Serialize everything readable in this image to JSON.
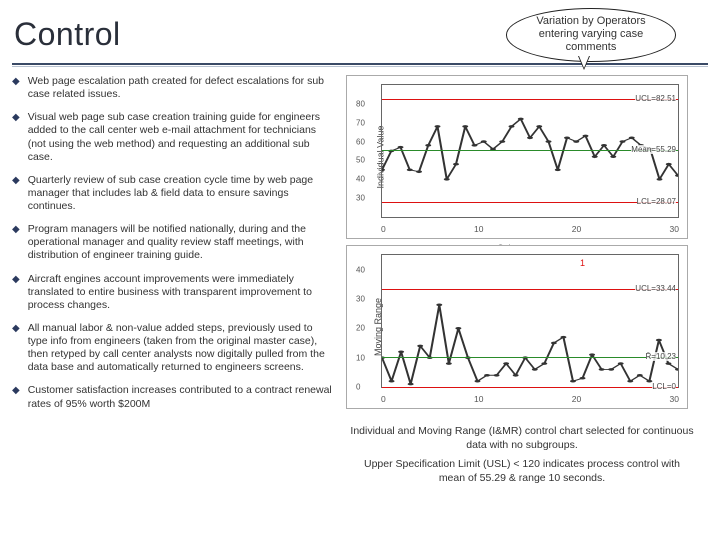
{
  "header": {
    "title": "Control"
  },
  "callout": {
    "text": "Variation by Operators entering varying case comments"
  },
  "bullets": [
    "Web page escalation path created for defect escalations for sub case related issues.",
    "Visual web page sub case creation training guide for engineers added to the call center web e-mail attachment for technicians (not using the web method) and requesting an additional sub case.",
    "Quarterly review of sub case creation cycle time by web page manager that includes lab & field data to ensure savings continues.",
    "Program managers will be notified nationally, during and the operational manager and quality review staff meetings, with distribution of engineer training guide.",
    "Aircraft engines account improvements were immediately translated to entire business with transparent improvement to process changes.",
    "All manual labor & non-value added steps, previously used to type info from engineers (taken from the original master case), then retyped by call center analysts now digitally pulled from the data base and automatically returned to engineers screens.",
    "Customer satisfaction increases contributed to a contract renewal rates of 95% worth $200M"
  ],
  "caption": {
    "line1": "Individual and Moving Range (I&MR) control chart selected for continuous data with no subgroups.",
    "line2": "Upper Specification Limit (USL) < 120 indicates process control with mean of 55.29 & range 10 seconds."
  },
  "chart_data": [
    {
      "type": "line",
      "title": "",
      "ylabel": "Individual Value",
      "xlabel": "Subgroup",
      "ylim": [
        20,
        90
      ],
      "yticks": [
        30,
        40,
        50,
        60,
        70,
        80
      ],
      "xticks": [
        0,
        10,
        20,
        30
      ],
      "reference_lines": [
        {
          "name": "UCL",
          "value": 82.51,
          "label": "UCL=82.51",
          "color": "red"
        },
        {
          "name": "Mean",
          "value": 55.29,
          "label": "Mean=55.29",
          "color": "green"
        },
        {
          "name": "LCL",
          "value": 28.07,
          "label": "LCL=28.07",
          "color": "red"
        }
      ],
      "x": [
        1,
        2,
        3,
        4,
        5,
        6,
        7,
        8,
        9,
        10,
        11,
        12,
        13,
        14,
        15,
        16,
        17,
        18,
        19,
        20,
        21,
        22,
        23,
        24,
        25,
        26,
        27,
        28,
        29,
        30,
        31,
        32,
        33
      ],
      "values": [
        45,
        55,
        57,
        45,
        44,
        58,
        68,
        40,
        48,
        68,
        58,
        60,
        56,
        60,
        68,
        72,
        62,
        68,
        60,
        45,
        62,
        60,
        63,
        52,
        58,
        52,
        60,
        62,
        58,
        56,
        40,
        48,
        42
      ]
    },
    {
      "type": "line",
      "title": "",
      "ylabel": "Moving Range",
      "xlabel": "",
      "ylim": [
        0,
        45
      ],
      "yticks": [
        0,
        10,
        20,
        30,
        40
      ],
      "xticks": [
        0,
        10,
        20,
        30
      ],
      "reference_lines": [
        {
          "name": "UCL",
          "value": 33.44,
          "label": "UCL=33.44",
          "color": "red"
        },
        {
          "name": "Rbar",
          "value": 10.23,
          "label": "R̄=10.23",
          "color": "green"
        },
        {
          "name": "LCL",
          "value": 0,
          "label": "LCL=0",
          "color": "red"
        }
      ],
      "x": [
        2,
        3,
        4,
        5,
        6,
        7,
        8,
        9,
        10,
        11,
        12,
        13,
        14,
        15,
        16,
        17,
        18,
        19,
        20,
        21,
        22,
        23,
        24,
        25,
        26,
        27,
        28,
        29,
        30,
        31,
        32,
        33
      ],
      "values": [
        10,
        2,
        12,
        1,
        14,
        10,
        28,
        8,
        20,
        10,
        2,
        4,
        4,
        8,
        4,
        10,
        6,
        8,
        15,
        17,
        2,
        3,
        11,
        6,
        6,
        8,
        2,
        4,
        2,
        16,
        8,
        6
      ],
      "out_of_control_points": [
        {
          "x": 23,
          "value": 40
        }
      ]
    }
  ]
}
